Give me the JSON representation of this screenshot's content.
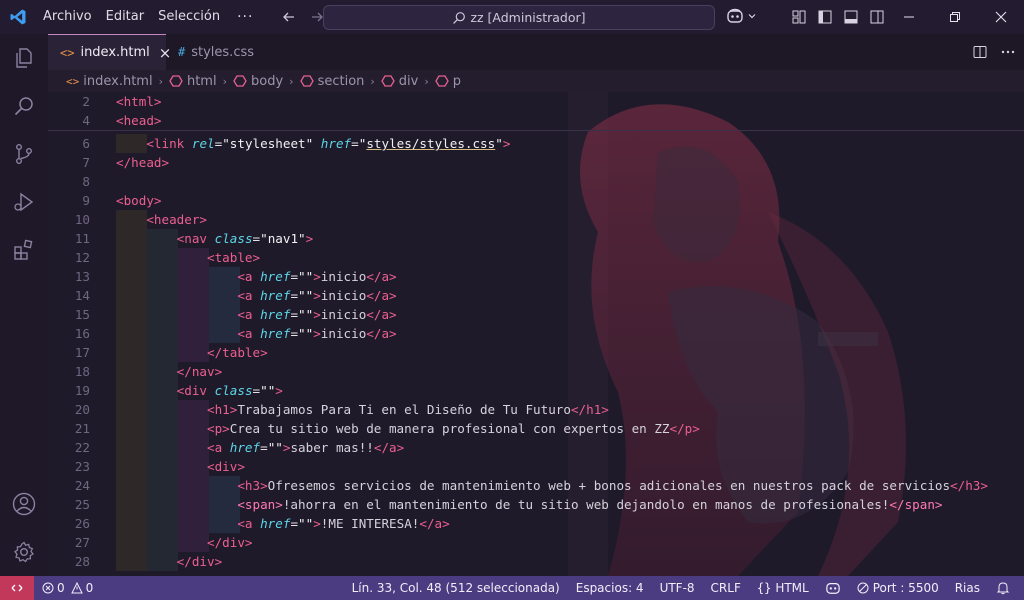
{
  "menu": {
    "items": [
      "Archivo",
      "Editar",
      "Selección"
    ],
    "more": "···"
  },
  "search": {
    "text": "zz [Administrador]"
  },
  "tabs": [
    {
      "icon": "<>",
      "label": "index.html",
      "close": "×"
    },
    {
      "icon": "#",
      "label": "styles.css"
    }
  ],
  "breadcrumb": [
    "index.html",
    "html",
    "body",
    "section",
    "div",
    "p"
  ],
  "code": [
    {
      "ln": "2",
      "html": "<span class=\"t\">&lt;html&gt;</span>",
      "d": 0
    },
    {
      "ln": "4",
      "html": "<span class=\"t\">&lt;head&gt;</span>",
      "d": 0
    },
    {
      "ln": "6",
      "html": "    <span class=\"t\">&lt;link</span> <span class=\"a\">rel</span><span class=\"p\">=</span><span class=\"s\">\"stylesheet\"</span> <span class=\"a\">href</span><span class=\"p\">=</span><span class=\"s\">\"<span class=\"u\">styles/styles.css</span>\"</span><span class=\"t\">&gt;</span>",
      "d": 1
    },
    {
      "ln": "7",
      "html": "<span class=\"t\">&lt;/head&gt;</span>",
      "d": 0
    },
    {
      "ln": "8",
      "html": "",
      "d": 0
    },
    {
      "ln": "9",
      "html": "<span class=\"t\">&lt;body&gt;</span>",
      "d": 0
    },
    {
      "ln": "10",
      "html": "    <span class=\"t\">&lt;header&gt;</span>",
      "d": 1
    },
    {
      "ln": "11",
      "html": "        <span class=\"t\">&lt;nav</span> <span class=\"a\">class</span><span class=\"p\">=</span><span class=\"s\">\"nav1\"</span><span class=\"t\">&gt;</span>",
      "d": 2
    },
    {
      "ln": "12",
      "html": "            <span class=\"t\">&lt;table&gt;</span>",
      "d": 3
    },
    {
      "ln": "13",
      "html": "                <span class=\"t\">&lt;a</span> <span class=\"a\">href</span><span class=\"p\">=</span><span class=\"s\">\"\"</span><span class=\"t\">&gt;</span>inicio<span class=\"t\">&lt;/a&gt;</span>",
      "d": 4
    },
    {
      "ln": "14",
      "html": "                <span class=\"t\">&lt;a</span> <span class=\"a\">href</span><span class=\"p\">=</span><span class=\"s\">\"\"</span><span class=\"t\">&gt;</span>inicio<span class=\"t\">&lt;/a&gt;</span>",
      "d": 4
    },
    {
      "ln": "15",
      "html": "                <span class=\"t\">&lt;a</span> <span class=\"a\">href</span><span class=\"p\">=</span><span class=\"s\">\"\"</span><span class=\"t\">&gt;</span>inicio<span class=\"t\">&lt;/a&gt;</span>",
      "d": 4
    },
    {
      "ln": "16",
      "html": "                <span class=\"t\">&lt;a</span> <span class=\"a\">href</span><span class=\"p\">=</span><span class=\"s\">\"\"</span><span class=\"t\">&gt;</span>inicio<span class=\"t\">&lt;/a&gt;</span>",
      "d": 4
    },
    {
      "ln": "17",
      "html": "            <span class=\"t\">&lt;/table&gt;</span>",
      "d": 3
    },
    {
      "ln": "18",
      "html": "        <span class=\"t\">&lt;/nav&gt;</span>",
      "d": 2
    },
    {
      "ln": "19",
      "html": "        <span class=\"t\">&lt;div</span> <span class=\"a\">class</span><span class=\"p\">=</span><span class=\"s\">\"\"</span><span class=\"t\">&gt;</span>",
      "d": 2
    },
    {
      "ln": "20",
      "html": "            <span class=\"t\">&lt;h1&gt;</span>Trabajamos Para Ti en el Diseño de Tu Futuro<span class=\"t\">&lt;/h1&gt;</span>",
      "d": 3
    },
    {
      "ln": "21",
      "html": "            <span class=\"t\">&lt;p&gt;</span>Crea tu sitio web de manera profesional con expertos en ZZ<span class=\"t\">&lt;/p&gt;</span>",
      "d": 3
    },
    {
      "ln": "22",
      "html": "            <span class=\"t\">&lt;a</span> <span class=\"a\">href</span><span class=\"p\">=</span><span class=\"s\">\"\"</span><span class=\"t\">&gt;</span>saber mas!!<span class=\"t\">&lt;/a&gt;</span>",
      "d": 3
    },
    {
      "ln": "23",
      "html": "            <span class=\"t\">&lt;div&gt;</span>",
      "d": 3
    },
    {
      "ln": "24",
      "html": "                <span class=\"t\">&lt;h3&gt;</span>Ofresemos servicios de mantenimiento web + bonos adicionales en nuestros pack de servicios<span class=\"t\">&lt;/h3&gt;</span>",
      "d": 4
    },
    {
      "ln": "25",
      "html": "                <span class=\"t2\">&lt;span&gt;</span>!ahorra en el mantenimiento de tu sitio web dejandolo en manos de profesionales!<span class=\"t2\">&lt;/span&gt;</span>",
      "d": 4
    },
    {
      "ln": "26",
      "html": "                <span class=\"t\">&lt;a</span> <span class=\"a\">href</span><span class=\"p\">=</span><span class=\"s\">\"\"</span><span class=\"t\">&gt;</span>!ME INTERESA!<span class=\"t\">&lt;/a&gt;</span>",
      "d": 4
    },
    {
      "ln": "27",
      "html": "            <span class=\"t\">&lt;/div&gt;</span>",
      "d": 3
    },
    {
      "ln": "28",
      "html": "        <span class=\"t\">&lt;/div&gt;</span>",
      "d": 2
    }
  ],
  "status": {
    "problems_errors": "0",
    "problems_warnings": "0",
    "cursor": "Lín. 33, Col. 48 (512 seleccionada)",
    "spaces": "Espacios: 4",
    "encoding": "UTF-8",
    "eol": "CRLF",
    "language": "HTML",
    "port": "Port : 5500",
    "rias": "Rias"
  },
  "colors": {
    "accent": "#4b3c82",
    "remote": "#c2385a",
    "tag": "#ec5f90",
    "attribute": "#5cd6e8",
    "string": "#f1f1f1"
  }
}
